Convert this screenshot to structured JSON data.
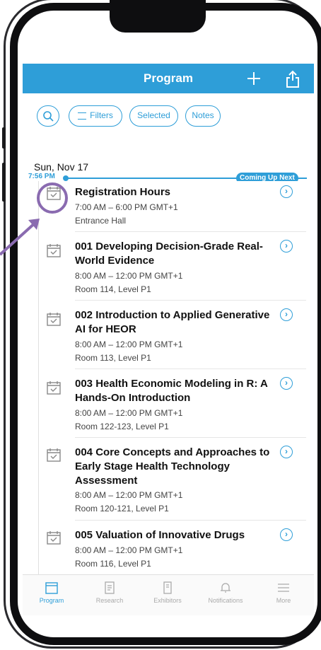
{
  "header": {
    "title": "Program",
    "add_icon": "plus-icon",
    "share_icon": "share-icon"
  },
  "toolbar": {
    "search_icon": "search-icon",
    "filters_label": "Filters",
    "selected_label": "Selected",
    "notes_label": "Notes"
  },
  "schedule": {
    "date": "Sun, Nov 17",
    "current_time": "7:56 PM",
    "coming_up": "Coming Up Next",
    "items": [
      {
        "title": "Registration Hours",
        "time": "7:00 AM – 6:00 PM GMT+1",
        "location": "Entrance Hall"
      },
      {
        "title": "001 Developing Decision-Grade Real-World Evidence",
        "time": "8:00 AM – 12:00 PM GMT+1",
        "location": "Room 114, Level P1"
      },
      {
        "title": "002 Introduction to Applied Generative AI for HEOR",
        "time": "8:00 AM – 12:00 PM GMT+1",
        "location": "Room 113, Level P1"
      },
      {
        "title": "003 Health Economic Modeling in R: A Hands-On Introduction",
        "time": "8:00 AM – 12:00 PM GMT+1",
        "location": "Room 122-123, Level P1"
      },
      {
        "title": "004 Core Concepts and Approaches to Early Stage Health Technology Assessment",
        "time": "8:00 AM – 12:00 PM GMT+1",
        "location": "Room 120-121, Level P1"
      },
      {
        "title": "005 Valuation of Innovative Drugs",
        "time": "8:00 AM – 12:00 PM GMT+1",
        "location": "Room 116, Level P1"
      }
    ]
  },
  "tabs": [
    {
      "label": "Program",
      "active": true
    },
    {
      "label": "Research",
      "active": false
    },
    {
      "label": "Exhibitors",
      "active": false
    },
    {
      "label": "Notifications",
      "active": false
    },
    {
      "label": "More",
      "active": false
    }
  ],
  "colors": {
    "accent": "#2e9ed8",
    "annotation": "#8a6bb0"
  }
}
